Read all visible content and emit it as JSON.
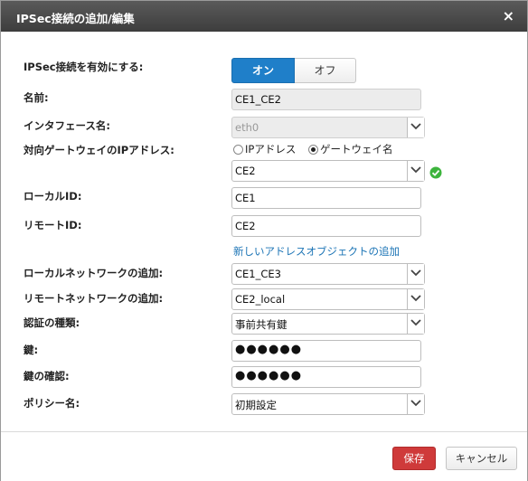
{
  "window": {
    "title": "IPSec接続の追加/編集",
    "close_symbol": "×"
  },
  "form": {
    "enable": {
      "label": "IPSec接続を有効にする:",
      "on_label": "オン",
      "off_label": "オフ",
      "selected": "オン"
    },
    "name": {
      "label": "名前:",
      "value": "CE1_CE2"
    },
    "interface": {
      "label": "インタフェース名:",
      "value": "eth0"
    },
    "peer": {
      "label": "対向ゲートウェイのIPアドレス:",
      "radio_ip": "IPアドレス",
      "radio_gateway": "ゲートウェイ名",
      "selected_radio": "ゲートウェイ名",
      "gateway_value": "CE2",
      "status_color": "#3cb43c"
    },
    "local_id": {
      "label": "ローカルID:",
      "value": "CE1"
    },
    "remote_id": {
      "label": "リモートID:",
      "value": "CE2"
    },
    "new_address_link": "新しいアドレスオブジェクトの追加",
    "local_network": {
      "label": "ローカルネットワークの追加:",
      "value": "CE1_CE3"
    },
    "remote_network": {
      "label": "リモートネットワークの追加:",
      "value": "CE2_local"
    },
    "auth_type": {
      "label": "認証の種類:",
      "value": "事前共有鍵"
    },
    "key": {
      "label": "鍵:",
      "value": "●●●●●●"
    },
    "key_confirm": {
      "label": "鍵の確認:",
      "value": "●●●●●●"
    },
    "policy": {
      "label": "ポリシー名:",
      "value": "初期設定"
    }
  },
  "footer": {
    "save_label": "保存",
    "cancel_label": "キャンセル"
  },
  "colors": {
    "accent": "#1f7fc9",
    "save": "#cf3a3a",
    "link": "#1a73b5",
    "titlebar": "#474747"
  }
}
